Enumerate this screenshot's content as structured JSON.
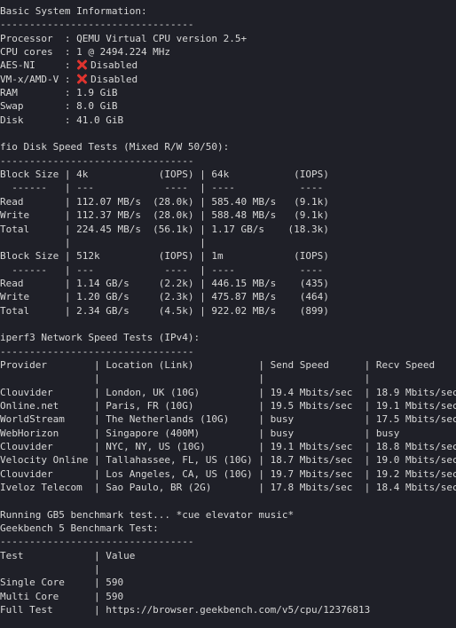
{
  "colors": {
    "background": "#1f2028",
    "text": "#d8d8d8",
    "cross_icon": "#e0342f"
  },
  "lines": [
    {
      "text": "Basic System Information:"
    },
    {
      "text": "---------------------------------"
    },
    {
      "text": "Processor  : QEMU Virtual CPU version 2.5+"
    },
    {
      "text": "CPU cores  : 1 @ 2494.224 MHz"
    },
    {
      "text": "AES-NI     : ",
      "icon": "cross-mark-icon",
      "suffix": "Disabled"
    },
    {
      "text": "VM-x/AMD-V : ",
      "icon": "cross-mark-icon",
      "suffix": "Disabled"
    },
    {
      "text": "RAM        : 1.9 GiB"
    },
    {
      "text": "Swap       : 8.0 GiB"
    },
    {
      "text": "Disk       : 41.0 GiB"
    },
    {
      "text": ""
    },
    {
      "text": "fio Disk Speed Tests (Mixed R/W 50/50):"
    },
    {
      "text": "---------------------------------"
    },
    {
      "text": "Block Size | 4k            (IOPS) | 64k           (IOPS)"
    },
    {
      "text": "  ------   | ---            ----  | ----           ---- "
    },
    {
      "text": "Read       | 112.07 MB/s  (28.0k) | 585.40 MB/s   (9.1k)"
    },
    {
      "text": "Write      | 112.37 MB/s  (28.0k) | 588.48 MB/s   (9.1k)"
    },
    {
      "text": "Total      | 224.45 MB/s  (56.1k) | 1.17 GB/s    (18.3k)"
    },
    {
      "text": "           |                      |                     "
    },
    {
      "text": "Block Size | 512k          (IOPS) | 1m            (IOPS)"
    },
    {
      "text": "  ------   | ---            ----  | ----           ---- "
    },
    {
      "text": "Read       | 1.14 GB/s     (2.2k) | 446.15 MB/s    (435)"
    },
    {
      "text": "Write      | 1.20 GB/s     (2.3k) | 475.87 MB/s    (464)"
    },
    {
      "text": "Total      | 2.34 GB/s     (4.5k) | 922.02 MB/s    (899)"
    },
    {
      "text": ""
    },
    {
      "text": "iperf3 Network Speed Tests (IPv4):"
    },
    {
      "text": "---------------------------------"
    },
    {
      "text": "Provider        | Location (Link)           | Send Speed      | Recv Speed"
    },
    {
      "text": "                |                           |                 |"
    },
    {
      "text": "Clouvider       | London, UK (10G)          | 19.4 Mbits/sec  | 18.9 Mbits/sec"
    },
    {
      "text": "Online.net      | Paris, FR (10G)           | 19.5 Mbits/sec  | 19.1 Mbits/sec"
    },
    {
      "text": "WorldStream     | The Netherlands (10G)     | busy            | 17.5 Mbits/sec"
    },
    {
      "text": "WebHorizon      | Singapore (400M)          | busy            | busy"
    },
    {
      "text": "Clouvider       | NYC, NY, US (10G)         | 19.1 Mbits/sec  | 18.8 Mbits/sec"
    },
    {
      "text": "Velocity Online | Tallahassee, FL, US (10G) | 18.7 Mbits/sec  | 19.0 Mbits/sec"
    },
    {
      "text": "Clouvider       | Los Angeles, CA, US (10G) | 19.7 Mbits/sec  | 19.2 Mbits/sec"
    },
    {
      "text": "Iveloz Telecom  | Sao Paulo, BR (2G)        | 17.8 Mbits/sec  | 18.4 Mbits/sec"
    },
    {
      "text": ""
    },
    {
      "text": "Running GB5 benchmark test... *cue elevator music*"
    },
    {
      "text": "Geekbench 5 Benchmark Test:"
    },
    {
      "text": "---------------------------------"
    },
    {
      "text": "Test            | Value"
    },
    {
      "text": "                |"
    },
    {
      "text": "Single Core     | 590"
    },
    {
      "text": "Multi Core      | 590"
    },
    {
      "text": "Full Test       | https://browser.geekbench.com/v5/cpu/12376813"
    }
  ]
}
